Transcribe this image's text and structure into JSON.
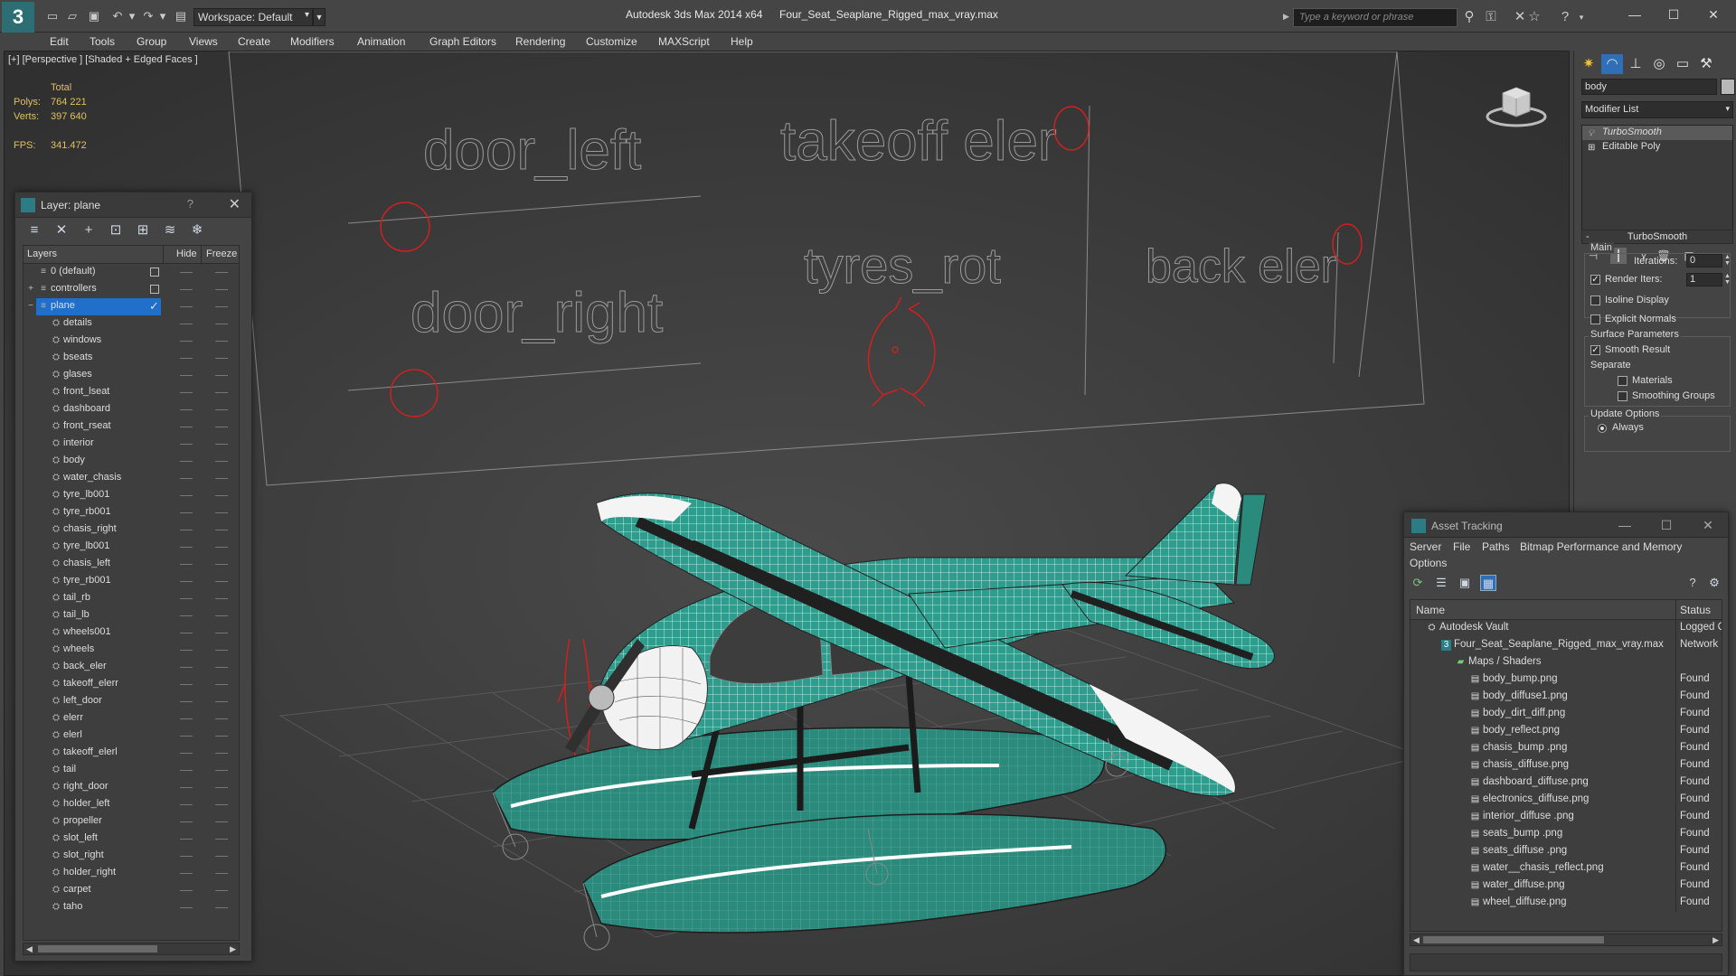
{
  "titlebar": {
    "app_title": "Autodesk 3ds Max  2014 x64",
    "file_title": "Four_Seat_Seaplane_Rigged_max_vray.max",
    "workspace": "Workspace: Default",
    "search_placeholder": "Type a keyword or phrase"
  },
  "menu": [
    "Edit",
    "Tools",
    "Group",
    "Views",
    "Create",
    "Modifiers",
    "Animation",
    "Graph Editors",
    "Rendering",
    "Customize",
    "MAXScript",
    "Help"
  ],
  "viewport": {
    "label": "[+] [Perspective ] [Shaded + Edged Faces ]",
    "stats": {
      "total_label": "Total",
      "polys_label": "Polys:",
      "polys": "764 221",
      "verts_label": "Verts:",
      "verts": "397 640",
      "fps_label": "FPS:",
      "fps": "341.472"
    },
    "controller_labels": {
      "door_left": "door_left",
      "door_right": "door_right",
      "takeoff_eler": "takeoff eler",
      "tyres_rot": "tyres_rot",
      "back_eler": "back eler"
    }
  },
  "layer_dialog": {
    "title": "Layer: plane",
    "help": "?",
    "col_layers": "Layers",
    "col_hide": "Hide",
    "col_freeze": "Freeze",
    "top_layers": [
      {
        "name": "0 (default)"
      },
      {
        "name": "controllers"
      },
      {
        "name": "plane"
      }
    ],
    "children": [
      "details",
      "windows",
      "bseats",
      "glases",
      "front_lseat",
      "dashboard",
      "front_rseat",
      "interior",
      "body",
      "water_chasis",
      "tyre_lb001",
      "tyre_rb001",
      "chasis_right",
      "tyre_lb001",
      "chasis_left",
      "tyre_rb001",
      "tail_rb",
      "tail_lb",
      "wheels001",
      "wheels",
      "back_eler",
      "takeoff_elerr",
      "left_door",
      "elerr",
      "elerl",
      "takeoff_elerl",
      "tail",
      "right_door",
      "holder_left",
      "propeller",
      "slot_left",
      "slot_right",
      "holder_right",
      "carpet",
      "taho"
    ]
  },
  "command_panel": {
    "object_name": "body",
    "modifier_list": "Modifier List",
    "stack": [
      "TurboSmooth",
      "Editable Poly"
    ],
    "rollout_title": "TurboSmooth",
    "main_group": "Main",
    "iterations_label": "Iterations:",
    "iterations": "0",
    "render_iters_label": "Render Iters:",
    "render_iters": "1",
    "isoline_label": "Isoline Display",
    "explicit_normals_label": "Explicit Normals",
    "surface_group": "Surface Parameters",
    "smooth_result_label": "Smooth Result",
    "separate_label": "Separate",
    "materials_label": "Materials",
    "smoothing_groups_label": "Smoothing Groups",
    "update_group": "Update Options",
    "always_label": "Always"
  },
  "asset_tracking": {
    "title": "Asset Tracking",
    "menu": [
      "Server",
      "File",
      "Paths",
      "Bitmap Performance and Memory"
    ],
    "menu_options": "Options",
    "col_name": "Name",
    "col_status": "Status",
    "rows": [
      {
        "name": "Autodesk Vault",
        "status": "Logged C",
        "level": 0,
        "icon": "vault-icon"
      },
      {
        "name": "Four_Seat_Seaplane_Rigged_max_vray.max",
        "status": "Network",
        "level": 1,
        "icon": "max-file-icon"
      },
      {
        "name": "Maps / Shaders",
        "status": "",
        "level": 2,
        "icon": "maps-folder-icon"
      },
      {
        "name": "body_bump.png",
        "status": "Found",
        "level": 3,
        "icon": "bitmap-icon"
      },
      {
        "name": "body_diffuse1.png",
        "status": "Found",
        "level": 3,
        "icon": "bitmap-icon"
      },
      {
        "name": "body_dirt_diff.png",
        "status": "Found",
        "level": 3,
        "icon": "bitmap-icon"
      },
      {
        "name": "body_reflect.png",
        "status": "Found",
        "level": 3,
        "icon": "bitmap-icon"
      },
      {
        "name": "chasis_bump .png",
        "status": "Found",
        "level": 3,
        "icon": "bitmap-icon"
      },
      {
        "name": "chasis_diffuse.png",
        "status": "Found",
        "level": 3,
        "icon": "bitmap-icon"
      },
      {
        "name": "dashboard_diffuse.png",
        "status": "Found",
        "level": 3,
        "icon": "bitmap-icon"
      },
      {
        "name": "electronics_diffuse.png",
        "status": "Found",
        "level": 3,
        "icon": "bitmap-icon"
      },
      {
        "name": "interior_diffuse .png",
        "status": "Found",
        "level": 3,
        "icon": "bitmap-icon"
      },
      {
        "name": "seats_bump .png",
        "status": "Found",
        "level": 3,
        "icon": "bitmap-icon"
      },
      {
        "name": "seats_diffuse .png",
        "status": "Found",
        "level": 3,
        "icon": "bitmap-icon"
      },
      {
        "name": "water__chasis_reflect.png",
        "status": "Found",
        "level": 3,
        "icon": "bitmap-icon"
      },
      {
        "name": "water_diffuse.png",
        "status": "Found",
        "level": 3,
        "icon": "bitmap-icon"
      },
      {
        "name": "wheel_diffuse.png",
        "status": "Found",
        "level": 3,
        "icon": "bitmap-icon"
      }
    ]
  },
  "colors": {
    "accent": "#2c7c85",
    "selection": "#1f6fcb",
    "plane_body": "#2f9d8d",
    "controller_red": "#d02020",
    "stats_yellow": "#e0c060"
  }
}
